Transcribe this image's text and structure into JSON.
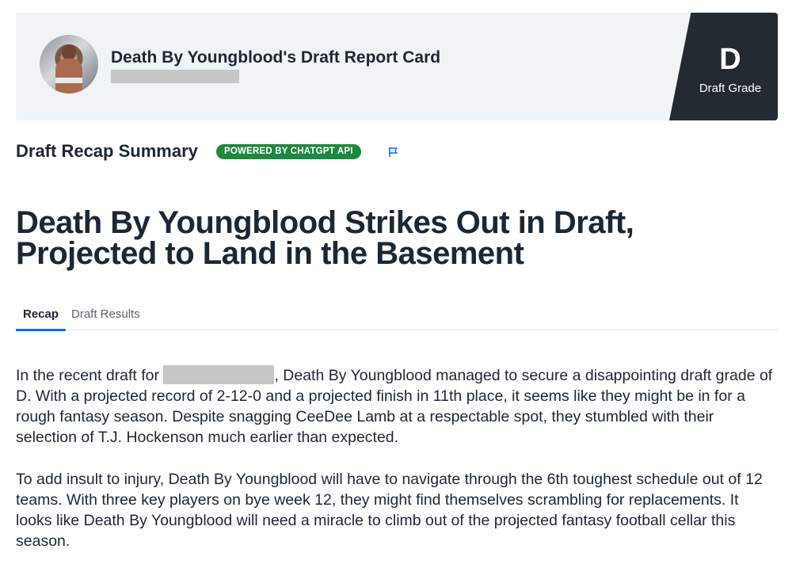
{
  "header": {
    "title": "Death By Youngblood's Draft Report Card",
    "grade": "D",
    "grade_label": "Draft Grade"
  },
  "summary": {
    "heading": "Draft Recap Summary",
    "badge": "POWERED BY CHATGPT API",
    "flag_icon": "flag-icon"
  },
  "headline": {
    "line1": "Death By Youngblood Strikes Out in Draft,",
    "line2": "Projected to Land in the Basement"
  },
  "tabs": [
    {
      "label": "Recap",
      "active": true
    },
    {
      "label": "Draft Results",
      "active": false
    }
  ],
  "recap": {
    "p1_before": "In the recent draft for ",
    "p1_after": ", Death By Youngblood managed to secure a disappointing draft grade of D. With a projected record of 2-12-0 and a projected finish in 11th place, it seems like they might be in for a rough fantasy season. Despite snagging CeeDee Lamb at a respectable spot, they stumbled with their selection of T.J. Hockenson much earlier than expected.",
    "p2": "To add insult to injury, Death By Youngblood will have to navigate through the 6th toughest schedule out of 12 teams. With three key players on bye week 12, they might find themselves scrambling for replacements. It looks like Death By Youngblood will need a miracle to climb out of the projected fantasy football cellar this season."
  },
  "colors": {
    "header_bg": "#f0f4f6",
    "grade_bg": "#232a31",
    "badge_bg": "#1a8a3d",
    "tab_accent": "#0f69ff",
    "flag": "#0f69ff"
  }
}
